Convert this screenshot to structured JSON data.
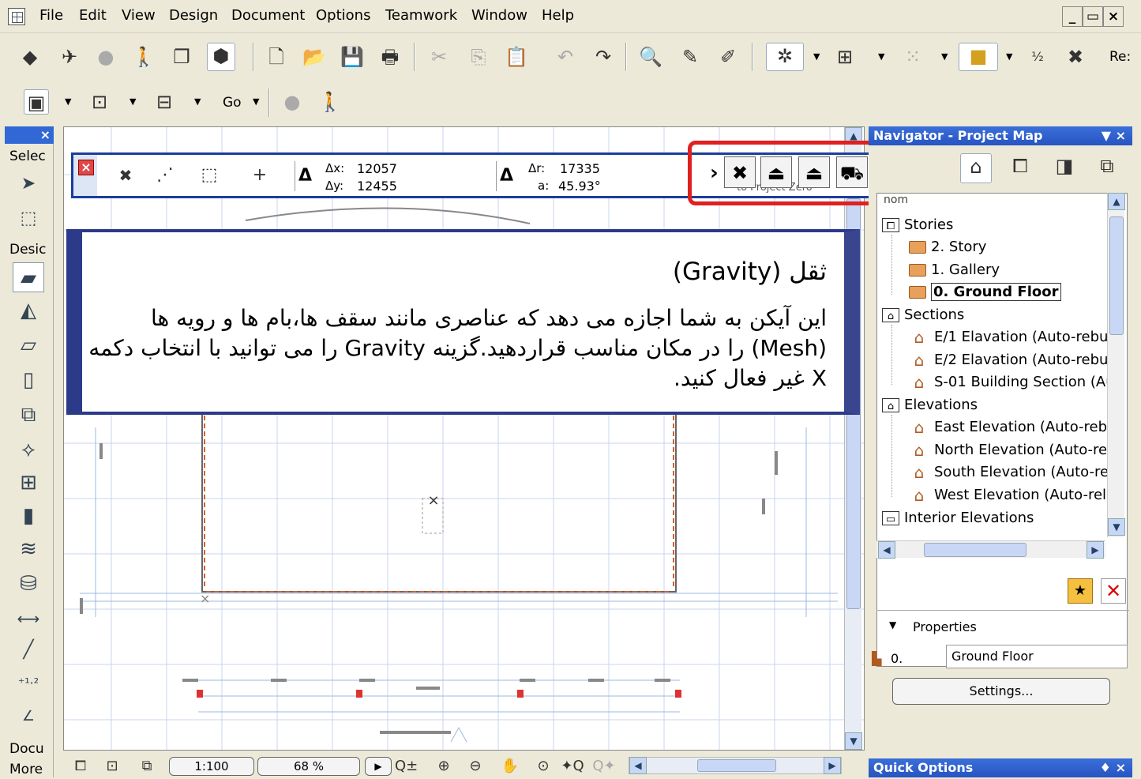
{
  "menubar": {
    "items": [
      "File",
      "Edit",
      "View",
      "Design",
      "Document",
      "Options",
      "Teamwork",
      "Window",
      "Help"
    ],
    "window_controls": [
      "_",
      "ð",
      "X"
    ]
  },
  "toolbar": {
    "truncated_label": "Re:",
    "go_label": "Go"
  },
  "toolbox": {
    "close": "×",
    "labels": [
      "Selec",
      "Desic",
      "Docu",
      "More"
    ]
  },
  "pet_palette": {
    "dx_label": "Δx:",
    "dx_value": "12057",
    "dy_label": "Δy:",
    "dy_value": "12455",
    "dr_label": "Δr:",
    "dr_value": "17335",
    "da_label": "a:",
    "da_value": "45.93°",
    "hidden_text": "to Project Zero"
  },
  "callout": {
    "title": "ثقل (Gravity)",
    "body": "این آیکن به شما اجازه می دهد که عناصری  مانند سقف ها،بام ها و رویه ها (Mesh) را در مکان مناسب قراردهید.گزینه Gravity را می توانید با انتخاب دکمه X غیر فعال کنید."
  },
  "navigator": {
    "title": "Navigator - Project Map",
    "title_controls": "▼ ×",
    "tree": [
      {
        "label": "Stories",
        "level": 0,
        "icon": "stories"
      },
      {
        "label": "2. Story",
        "level": 1,
        "icon": "folder"
      },
      {
        "label": "1. Gallery",
        "level": 1,
        "icon": "folder"
      },
      {
        "label": "0. Ground Floor",
        "level": 1,
        "icon": "folder",
        "selected": true
      },
      {
        "label": "Sections",
        "level": 0,
        "icon": "sections"
      },
      {
        "label": "E/1 Elavation (Auto-rebu",
        "level": 1,
        "icon": "house"
      },
      {
        "label": "E/2 Elavation (Auto-rebu",
        "level": 1,
        "icon": "house"
      },
      {
        "label": "S-01 Building Section (Au",
        "level": 1,
        "icon": "house"
      },
      {
        "label": "Elevations",
        "level": 0,
        "icon": "sections"
      },
      {
        "label": "East Elevation (Auto-reb",
        "level": 1,
        "icon": "house"
      },
      {
        "label": "North Elevation (Auto-re",
        "level": 1,
        "icon": "house"
      },
      {
        "label": "South Elevation (Auto-re",
        "level": 1,
        "icon": "house"
      },
      {
        "label": "West Elevation (Auto-rel",
        "level": 1,
        "icon": "house"
      },
      {
        "label": "Interior Elevations",
        "level": 0,
        "icon": "interior"
      }
    ],
    "properties_label": "Properties",
    "story_number": "0.",
    "story_name": "Ground Floor",
    "settings_button": "Settings..."
  },
  "quick_options": {
    "title": "Quick Options",
    "controls": "♦ ×"
  },
  "statusbar": {
    "scale": "1:100",
    "zoom": "68 %"
  }
}
